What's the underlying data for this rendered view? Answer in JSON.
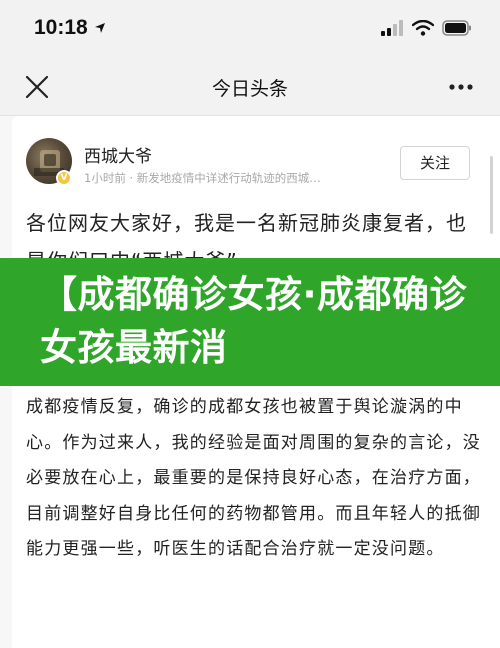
{
  "status_bar": {
    "time": "10:18",
    "location_icon": "location-arrow-icon",
    "icons": [
      "cellular-signal-icon",
      "wifi-icon",
      "battery-icon"
    ]
  },
  "nav": {
    "title": "今日头条",
    "close_icon": "close-icon",
    "more_icon": "more-icon"
  },
  "author": {
    "name": "西城大爷",
    "meta": "1小时前 · 新发地疫情中详述行动轨迹的西城…",
    "verified_badge": "V",
    "follow_label": "关注"
  },
  "article": {
    "first_paragraph": "各位网友大家好，我是一名新冠肺炎康复者，也是你们口中“西城大爷”",
    "body": "成都疫情反复，确诊的成都女孩也被置于舆论漩涡的中心。作为过来人，我的经验是面对周围的复杂的言论，没必要放在心上，最重要的是保持良好心态，在治疗方面，目前调整好自身比任何的药物都管用。而且年轻人的抵御能力更强一些，听医生的话配合治疗就一定没问题。"
  },
  "banner": {
    "text": "【成都确诊女孩·成都确诊女孩最新消",
    "background": "#2fa629"
  },
  "colors": {
    "link_gray": "#a8a8a8",
    "badge": "#f3c641"
  }
}
